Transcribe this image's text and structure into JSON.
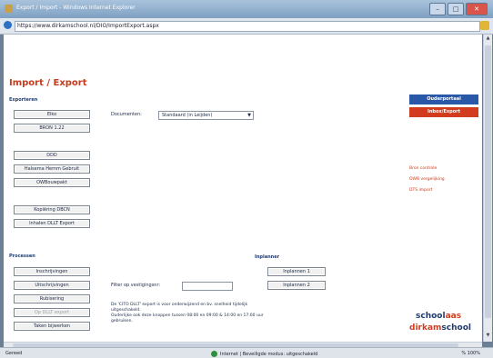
{
  "window": {
    "title": "Export / Import - Windows Internet Explorer",
    "url": "https://www.dirkamschool.nl/DIO/ImportExport.aspx",
    "minimize": "–",
    "maximize": "□",
    "close": "✕"
  },
  "page": {
    "heading": "Import / Export",
    "exporteren": {
      "label": "Exporteren",
      "buttons": [
        "Elko",
        "BRON 1.22",
        "DDD",
        "Halsema Hemm Gebruit",
        "OWBouwpakt",
        "Kopiëring DBCN",
        "Inhalen DLLT Export"
      ]
    },
    "document": {
      "label": "Documenten:",
      "selected": "Standaard (in Leijden)"
    },
    "processen": {
      "label": "Processen",
      "buttons": [
        "Inschrijvingen",
        "Uitschrijvingen",
        "Rubisering",
        "Op DLLT export",
        "Taken bijwerken"
      ]
    },
    "filter_label": "Filter op vestigingsnr:",
    "note_lines": [
      "De 'CITO DLLT' export is voor onderwijzend en bv. snelheid tijdelijk uitgeschakeld.",
      "Ouderlijke ook deze knoppen tussen 08:00 en 09:00 & 14:00 en 17:00 uur gebruiken."
    ],
    "inplanner": {
      "label": "Inplanner",
      "buttons": [
        "Inplannen 1",
        "Inplannen 2"
      ]
    },
    "right_buttons": {
      "blue": "Ouderportaal",
      "red": "Inbox/Export"
    },
    "right_links": [
      "Bron controle",
      "OWB vergelijking",
      "DTS import"
    ],
    "logo": {
      "line1_a": "school",
      "line1_b": "aas",
      "line2_a": "dirkam",
      "line2_b": "school"
    }
  },
  "statusbar": {
    "left": "Gereed",
    "zone": "Internet | Beveiligde modus: uitgeschakeld",
    "zoom": "% 100%"
  },
  "colors": {
    "accent_red": "#c63b1c",
    "accent_blue": "#2a58a8"
  }
}
